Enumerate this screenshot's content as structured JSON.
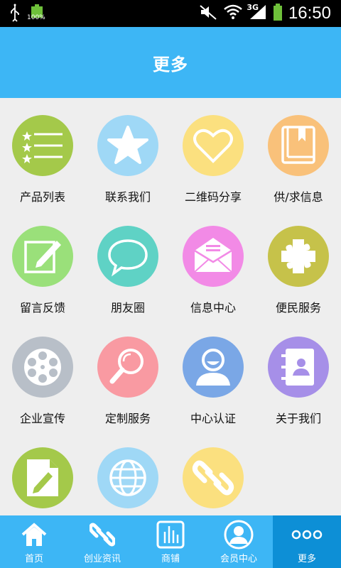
{
  "status_bar": {
    "battery_percent": "100%",
    "network": "3G",
    "time": "16:50"
  },
  "header": {
    "title": "更多"
  },
  "grid_items": [
    {
      "label": "产品列表",
      "icon": "list-icon",
      "color": "#a4c94a"
    },
    {
      "label": "联系我们",
      "icon": "star-icon",
      "color": "#9fd8f6"
    },
    {
      "label": "二维码分享",
      "icon": "heart-icon",
      "color": "#fbe07f"
    },
    {
      "label": "供/求信息",
      "icon": "book-icon",
      "color": "#f9c17a"
    },
    {
      "label": "留言反馈",
      "icon": "edit-icon",
      "color": "#9ae07a"
    },
    {
      "label": "朋友圈",
      "icon": "chat-bubble-icon",
      "color": "#5fd2c5"
    },
    {
      "label": "信息中心",
      "icon": "envelope-icon",
      "color": "#f28ae6"
    },
    {
      "label": "便民服务",
      "icon": "puzzle-icon",
      "color": "#c6c24a"
    },
    {
      "label": "企业宣传",
      "icon": "film-reel-icon",
      "color": "#b8bfc8"
    },
    {
      "label": "定制服务",
      "icon": "magnifier-icon",
      "color": "#f99aa2"
    },
    {
      "label": "中心认证",
      "icon": "user-icon",
      "color": "#7aa7e6"
    },
    {
      "label": "关于我们",
      "icon": "contact-book-icon",
      "color": "#a68fe8"
    },
    {
      "label": "",
      "icon": "document-edit-icon",
      "color": "#a4c94a"
    },
    {
      "label": "",
      "icon": "globe-icon",
      "color": "#9fd8f6"
    },
    {
      "label": "",
      "icon": "link-icon",
      "color": "#fbe07f"
    }
  ],
  "tab_bar": {
    "tabs": [
      {
        "label": "首页",
        "icon": "home-icon",
        "active": false
      },
      {
        "label": "创业资讯",
        "icon": "link-icon",
        "active": false
      },
      {
        "label": "商铺",
        "icon": "chart-icon",
        "active": false
      },
      {
        "label": "会员中心",
        "icon": "user-icon",
        "active": false
      },
      {
        "label": "更多",
        "icon": "more-dots-icon",
        "active": true
      }
    ]
  }
}
